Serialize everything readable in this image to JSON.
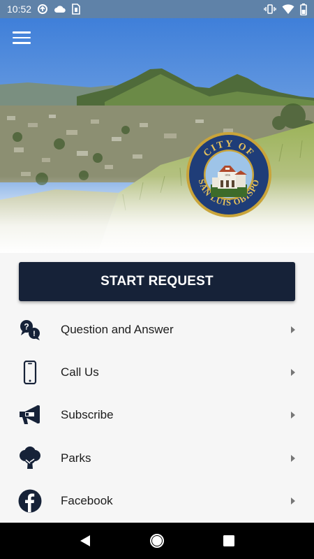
{
  "status_bar": {
    "time": "10:52",
    "left_icons": [
      "data-saver-icon",
      "cloud-icon",
      "sim-card-icon"
    ],
    "right_icons": [
      "vibrate-icon",
      "wifi-icon",
      "battery-icon"
    ],
    "background": "#5f82a8"
  },
  "hero": {
    "menu_icon": "hamburger-menu-icon",
    "seal": {
      "top_text": "CITY OF",
      "bottom_text": "SAN LUIS OBISPO",
      "year": "1856"
    }
  },
  "main": {
    "start_button_label": "START REQUEST",
    "accent": "#162238",
    "menu_items": [
      {
        "label": "Question and Answer",
        "icon": "question-answer-icon"
      },
      {
        "label": "Call Us",
        "icon": "phone-icon"
      },
      {
        "label": "Subscribe",
        "icon": "megaphone-icon"
      },
      {
        "label": "Parks",
        "icon": "tree-icon"
      },
      {
        "label": "Facebook",
        "icon": "facebook-icon"
      }
    ]
  },
  "nav_bar": {
    "buttons": [
      "back-icon",
      "home-icon",
      "recents-icon"
    ]
  }
}
